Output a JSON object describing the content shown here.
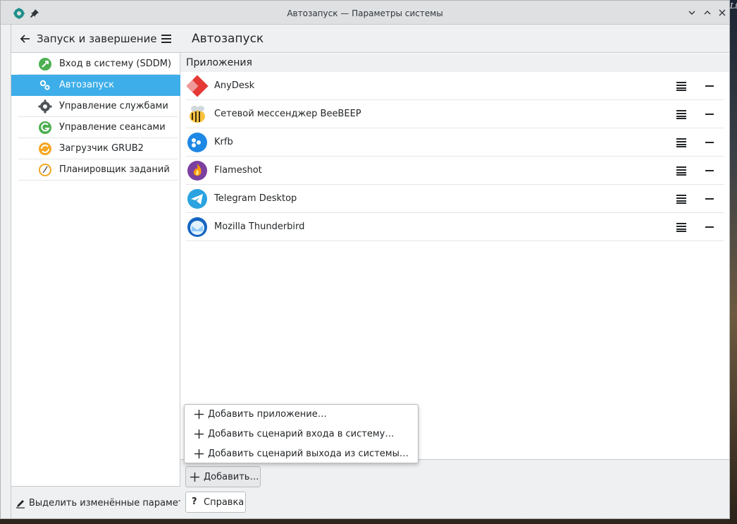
{
  "desktop": {
    "corner_text": "Li"
  },
  "window": {
    "title": "Автозапуск — Параметры системы",
    "app_icon": "system-settings-icon",
    "pin_icon": "pin-icon"
  },
  "sidebar": {
    "header": {
      "title": "Запуск и завершение",
      "back_icon": "back-arrow-icon",
      "menu_icon": "hamburger-menu-icon"
    },
    "items": [
      {
        "label": "Вход в систему (SDDM)",
        "icon": "sddm-icon",
        "selected": false
      },
      {
        "label": "Автозапуск",
        "icon": "autostart-gears-icon",
        "selected": true
      },
      {
        "label": "Управление службами",
        "icon": "services-gear-icon",
        "selected": false
      },
      {
        "label": "Управление сеансами",
        "icon": "session-icon",
        "selected": false
      },
      {
        "label": "Загрузчик GRUB2",
        "icon": "grub-icon",
        "selected": false
      },
      {
        "label": "Планировщик заданий",
        "icon": "scheduler-clock-icon",
        "selected": false
      }
    ],
    "footer": {
      "label": "Выделить изменённые параметры",
      "icon": "highlight-pen-icon"
    }
  },
  "main": {
    "title": "Автозапуск",
    "section_title": "Приложения",
    "apps": [
      {
        "name": "AnyDesk",
        "icon": "anydesk-icon"
      },
      {
        "name": "Сетевой мессенджер BeeBEEP",
        "icon": "beebeep-icon"
      },
      {
        "name": "Krfb",
        "icon": "krfb-icon"
      },
      {
        "name": "Flameshot",
        "icon": "flameshot-icon"
      },
      {
        "name": "Telegram Desktop",
        "icon": "telegram-icon"
      },
      {
        "name": "Mozilla Thunderbird",
        "icon": "thunderbird-icon"
      }
    ],
    "add_button": "Добавить…",
    "help_button": "Справка"
  },
  "add_menu": {
    "items": [
      {
        "label": "Добавить приложение…"
      },
      {
        "label": "Добавить сценарий входа в систему…"
      },
      {
        "label": "Добавить сценарий выхода из системы…"
      }
    ]
  },
  "colors": {
    "accent": "#3daee9",
    "window_bg": "#eff0f1",
    "text": "#232629"
  }
}
